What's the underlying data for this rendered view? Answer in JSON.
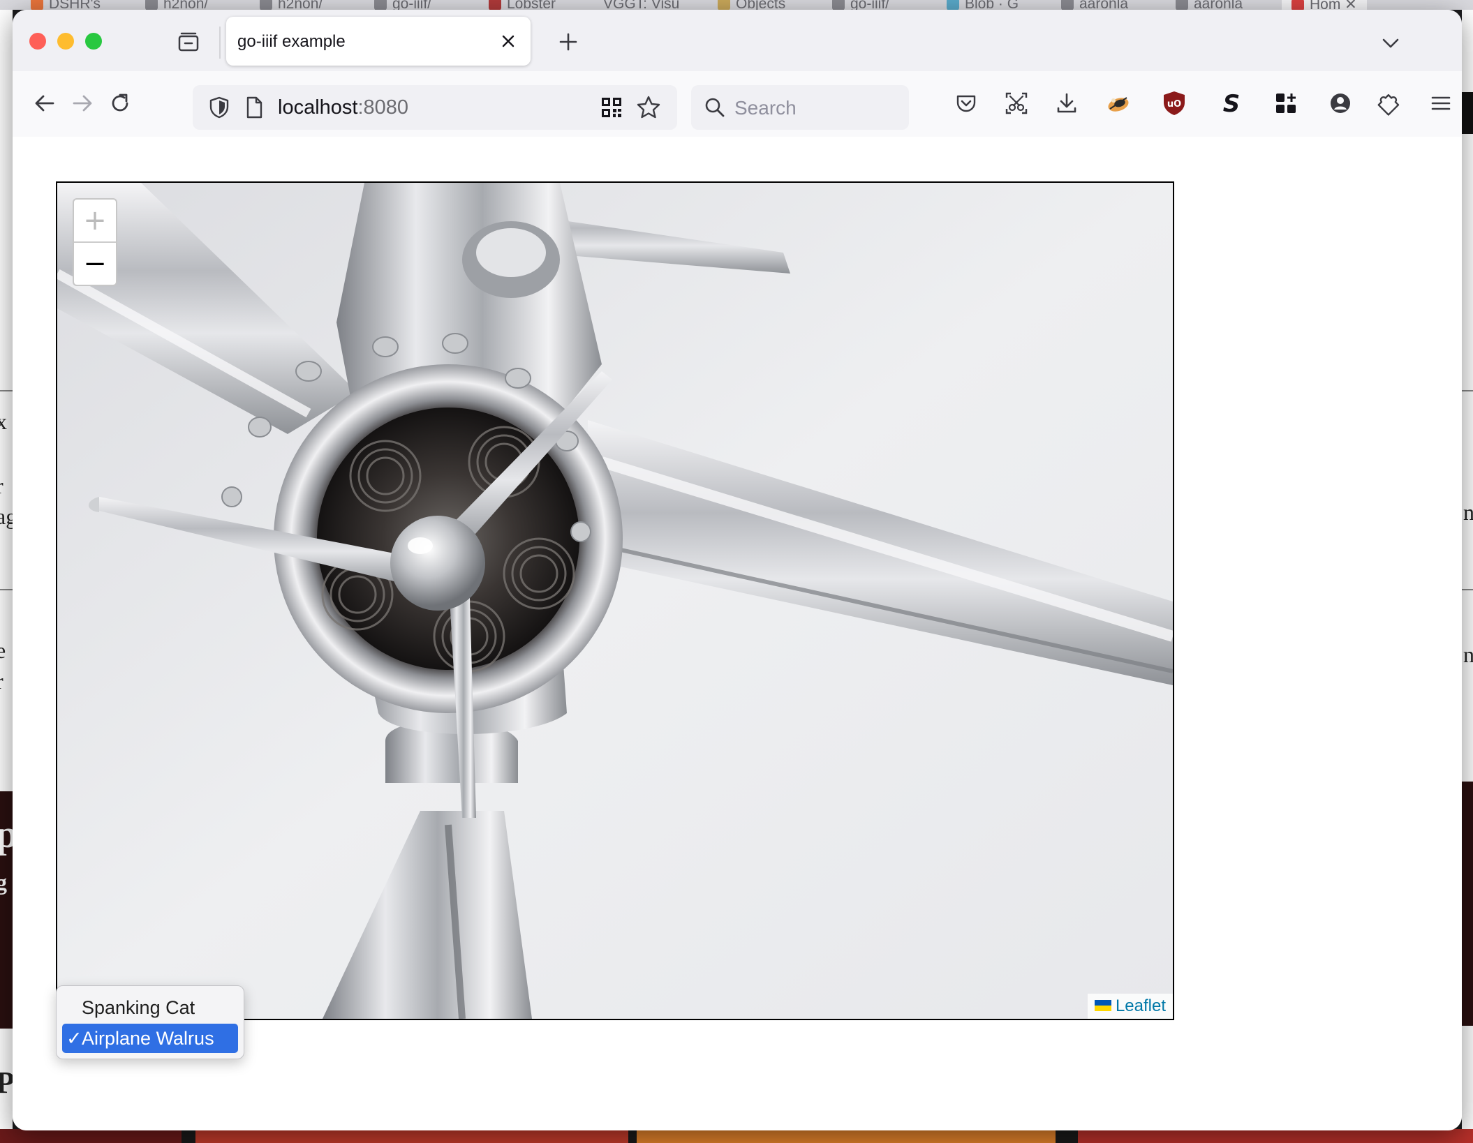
{
  "background_tabs": [
    "DSHR's",
    "h2non/",
    "h2non/",
    "go-iiif/",
    "Lobster",
    "VGGT: Visu",
    "Objects",
    "go-iiif/",
    "Blob · G",
    "aaronla",
    "aaronla",
    "Hom"
  ],
  "background_fragments": {
    "left": [
      "x",
      "r",
      "ag",
      "e",
      "r",
      "p",
      "g",
      "P"
    ],
    "right": [
      "n",
      "n"
    ]
  },
  "tab": {
    "title": "go-iiif example"
  },
  "urlbar": {
    "host": "localhost",
    "port": ":8080"
  },
  "search": {
    "placeholder": "Search"
  },
  "map": {
    "zoom_in_label": "+",
    "zoom_out_label": "−",
    "zoom_in_enabled": false,
    "attribution": "Leaflet"
  },
  "image_select": {
    "options": [
      {
        "label": "Spanking Cat",
        "selected": false
      },
      {
        "label": "Airplane Walrus",
        "selected": true
      }
    ],
    "check_mark": "✓",
    "selected_color": "#2f6fe4"
  },
  "toolbar_icons": [
    "back-icon",
    "forward-icon",
    "reload-icon",
    "pocket-icon",
    "screenshot-icon",
    "downloads-icon",
    "extension-icon",
    "ublock-icon",
    "s-extension-icon",
    "grid-extension-icon",
    "account-icon",
    "extensions-puzzle-icon",
    "menu-icon"
  ],
  "colors": {
    "close_red": "#fe5f57",
    "minimize_yellow": "#febc2e",
    "zoom_green": "#28c840",
    "ublock_red": "#8b1a1a",
    "link_blue": "#0078a8"
  }
}
